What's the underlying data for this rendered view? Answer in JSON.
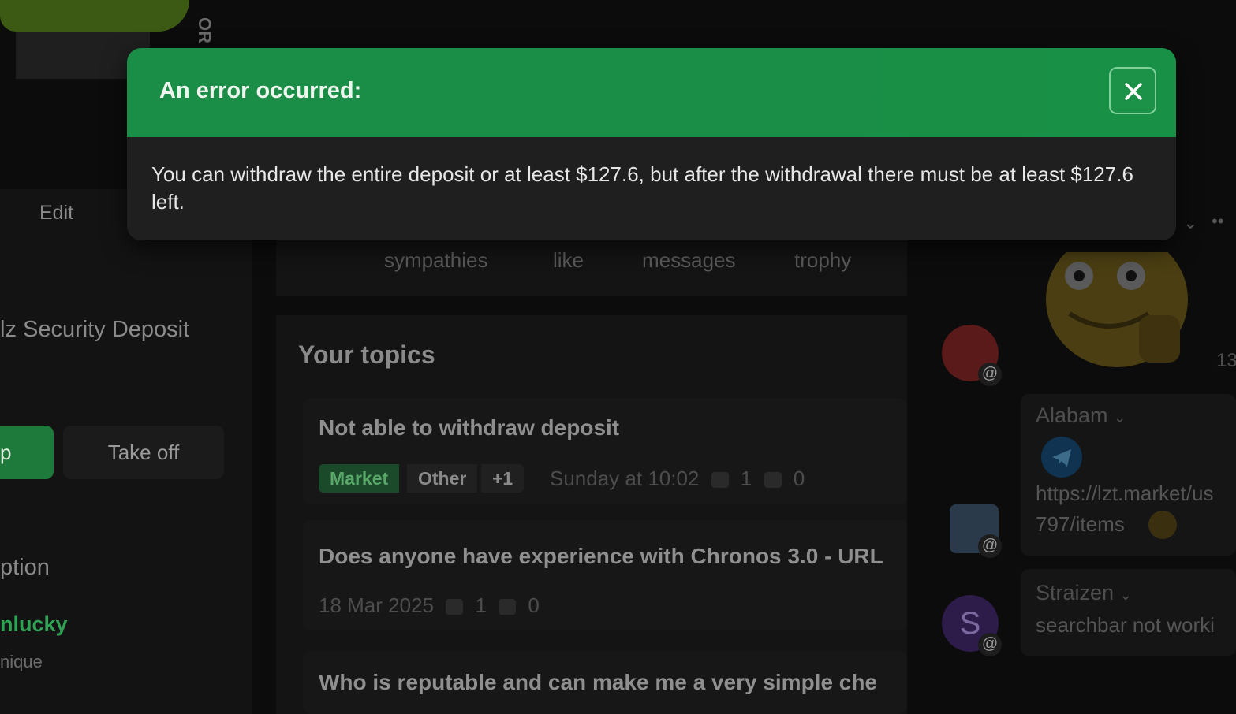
{
  "logo": {
    "vertical_text": "OR"
  },
  "left": {
    "edit_label": "Edit",
    "deposit_title": "lz Security Deposit",
    "green_button_label": "p",
    "take_off_label": "Take off",
    "option_label": "ption",
    "username": "nlucky",
    "user_subtitle": "nique"
  },
  "stats": {
    "items": [
      "sympathies",
      "like",
      "messages",
      "trophy"
    ]
  },
  "topics": {
    "title": "Your topics",
    "items": [
      {
        "title": "Not able to withdraw deposit",
        "tags": [
          "Market",
          "Other",
          "+1"
        ],
        "date": "Sunday at 10:02",
        "replies": "1",
        "likes": "0"
      },
      {
        "title": "Does anyone have experience with Chronos 3.0 - URL",
        "date": "18 Mar 2025",
        "replies": "1",
        "likes": "0"
      },
      {
        "title": "Who is reputable and can make me a very simple che"
      }
    ]
  },
  "avatars": {
    "letter": "S",
    "at_symbol": "@"
  },
  "chat": {
    "number_fragment": "13",
    "items": [
      {
        "user": "Alabam",
        "text_line1": "https://lzt.market/us",
        "text_line2": "797/items"
      },
      {
        "user": "Straizen",
        "text_line1": "searchbar not worki"
      }
    ]
  },
  "modal": {
    "title": "An error occurred:",
    "message": "You can withdraw the entire deposit or at least $127.6, but after the withdrawal there must be at least $127.6 left.",
    "close_icon": "close-icon"
  },
  "colors": {
    "modal_header": "#1a8e46",
    "modal_body": "#1f1f1f",
    "accent_green": "#2fa353"
  }
}
